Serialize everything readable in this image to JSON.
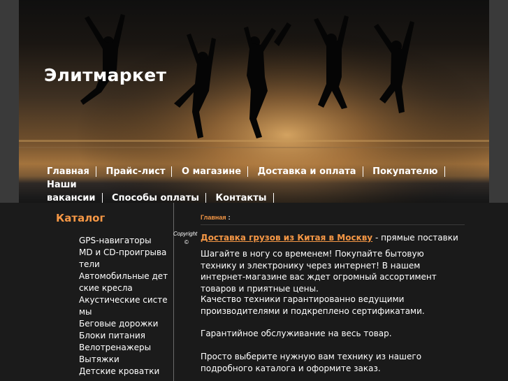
{
  "site": {
    "title": "Элитмаркет"
  },
  "nav": {
    "items": [
      "Главная",
      "Прайс-лист",
      "О магазине",
      "Доставка и оплата",
      "Покупателю",
      "Наши вакансии",
      "Способы оплаты",
      "Контакты"
    ],
    "vakansii_part1": "Наши",
    "vakansii_part2": "вакансии"
  },
  "catalog": {
    "title": "Каталог",
    "items": [
      "GPS-навигаторы",
      "MD и CD-проигрыватели",
      "Автомобильные детские кресла",
      "Акустические системы",
      "Беговые дорожки",
      "Блоки питания",
      "Велотренажеры",
      "Вытяжки",
      "Детские кроватки"
    ]
  },
  "footer": {
    "copyright": "Copyright",
    "copyright_symbol": "©"
  },
  "content": {
    "breadcrumb": "Главная",
    "breadcrumb_sep": ":",
    "lead_link": "Доставка грузов из Китая в Москву",
    "lead_rest": " - прямые поставки",
    "paragraphs": [
      "Шагайте в ногу со временем! Покупайте бытовую технику и электронику через интернет! В нашем интернет-магазине вас ждет огромный ассортимент товаров и приятные цены.",
      "Качество техники гарантированно ведущими производителями и подкреплено сертификатами.",
      "Гарантийное обслуживание на весь товар.",
      "Просто выберите нужную вам технику из нашего подробного каталога и оформите заказ."
    ]
  },
  "colors": {
    "accent": "#f59745",
    "page_bg": "#525252",
    "panel_bg": "#1a1a1a"
  }
}
